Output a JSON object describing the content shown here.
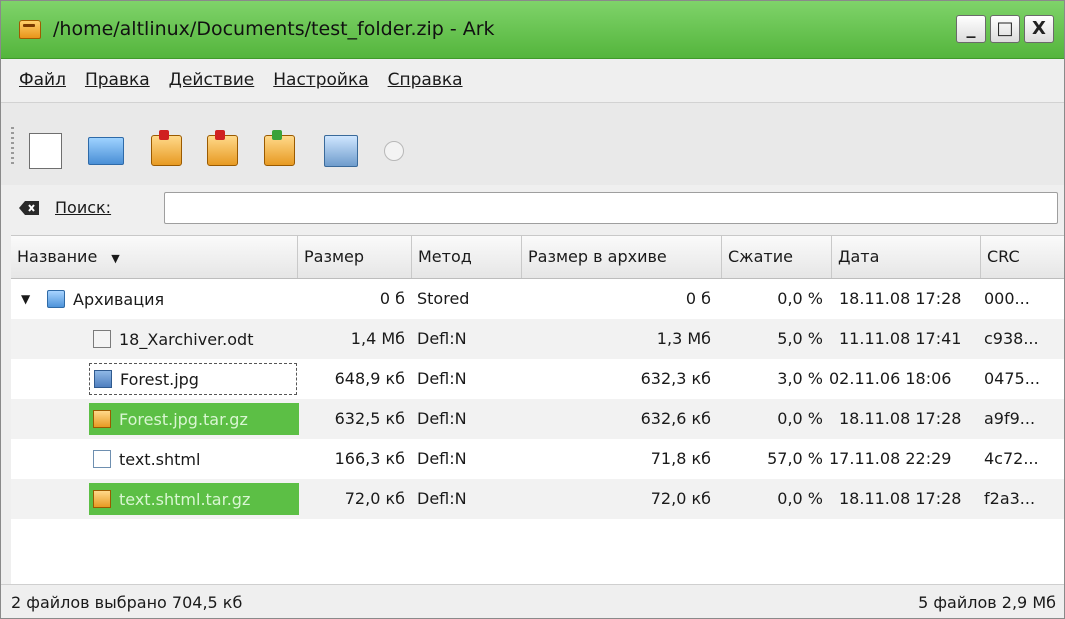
{
  "window": {
    "title": "/home/altlinux/Documents/test_folder.zip - Ark",
    "minimize": "_",
    "maximize": "□",
    "close": "X"
  },
  "menu": [
    "Файл",
    "Правка",
    "Действие",
    "Настройка",
    "Справка"
  ],
  "toolbar": [
    "new-icon",
    "open-icon",
    "add-files-icon",
    "add-folder-icon",
    "extract-icon",
    "test-icon",
    "stop-icon"
  ],
  "search": {
    "label": "Поиск:",
    "value": ""
  },
  "columns": [
    "Название",
    "Размер",
    "Метод",
    "Размер в архиве",
    "Сжатие",
    "Дата",
    "CRC"
  ],
  "rows": [
    {
      "name": "Архивация",
      "size": "0 б",
      "method": "Stored",
      "packed": "0 б",
      "ratio": "0,0 %",
      "date": "18.11.08 17:28",
      "crc": "000...",
      "icon": "folder-icon",
      "expanded": true
    },
    {
      "name": "18_Xarchiver.odt",
      "size": "1,4 Мб",
      "method": "Defl:N",
      "packed": "1,3 Мб",
      "ratio": "5,0 %",
      "date": "11.11.08 17:41",
      "crc": "c938...",
      "icon": "document-icon"
    },
    {
      "name": "Forest.jpg",
      "size": "648,9 кб",
      "method": "Defl:N",
      "packed": "632,3 кб",
      "ratio": "3,0 %",
      "date": "02.11.06 18:06",
      "crc": "0475...",
      "icon": "image-icon",
      "focused": true
    },
    {
      "name": "Forest.jpg.tar.gz",
      "size": "632,5 кб",
      "method": "Defl:N",
      "packed": "632,6 кб",
      "ratio": "0,0 %",
      "date": "18.11.08 17:28",
      "crc": "a9f9...",
      "icon": "archive-icon",
      "selected": true
    },
    {
      "name": "text.shtml",
      "size": "166,3 кб",
      "method": "Defl:N",
      "packed": "71,8 кб",
      "ratio": "57,0 %",
      "date": "17.11.08 22:29",
      "crc": "4c72...",
      "icon": "html-file-icon"
    },
    {
      "name": "text.shtml.tar.gz",
      "size": "72,0 кб",
      "method": "Defl:N",
      "packed": "72,0 кб",
      "ratio": "0,0 %",
      "date": "18.11.08 17:28",
      "crc": "f2a3...",
      "icon": "archive-icon",
      "selected": true
    }
  ],
  "status": {
    "left": "2 файлов выбрано  704,5 кб",
    "right": "5 файлов 2,9 Мб"
  },
  "colors": {
    "titlebar": "#5cbf45",
    "selection": "#5cbf45"
  }
}
